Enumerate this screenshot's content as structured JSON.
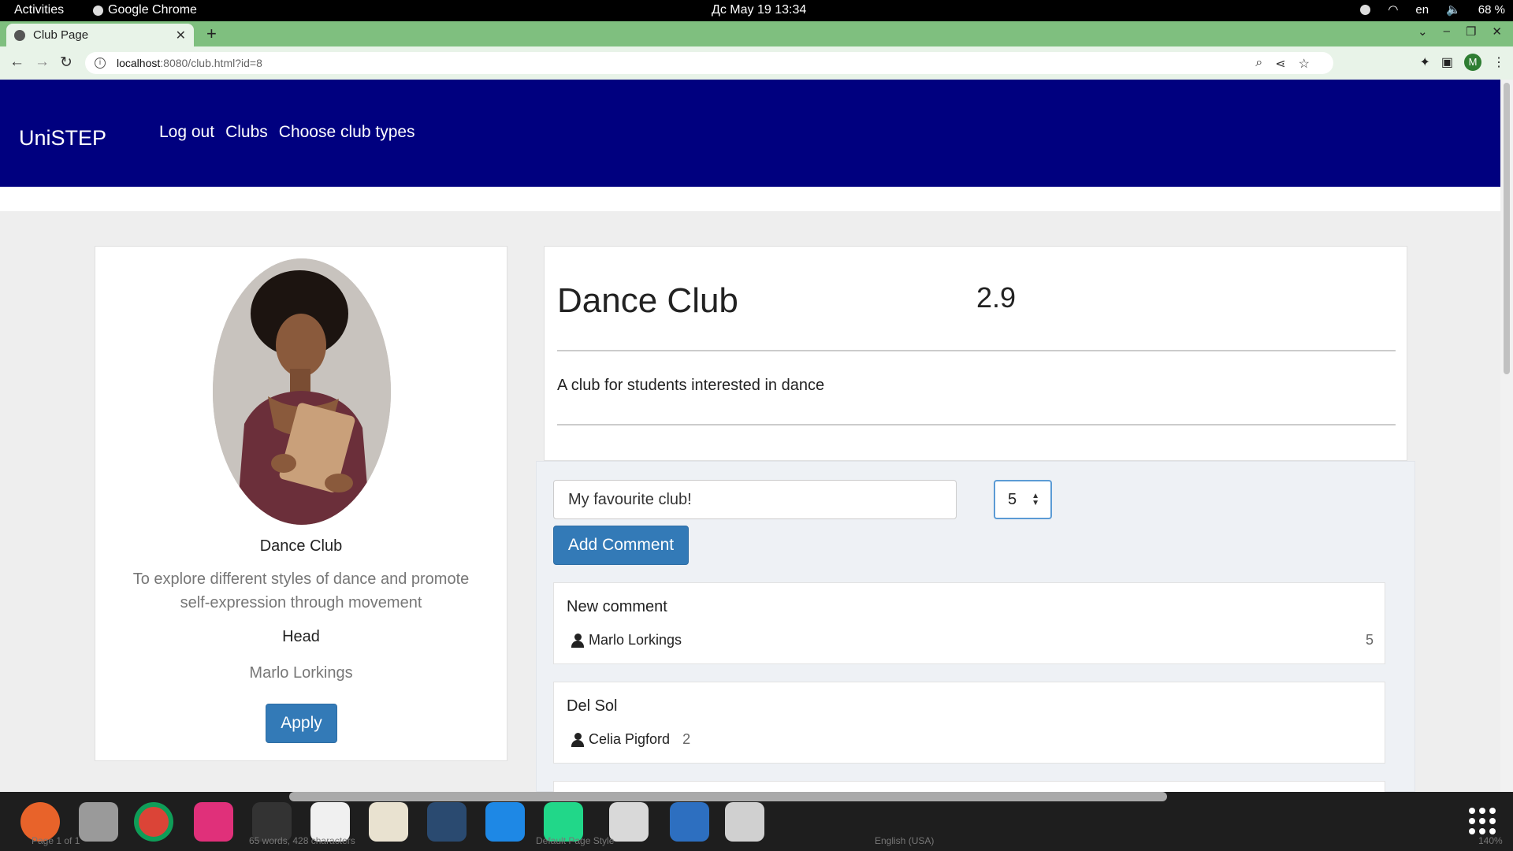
{
  "system": {
    "activities": "Activities",
    "app_name": "Google Chrome",
    "clock": "Дс May 19  13:34",
    "language": "en",
    "battery": "68 %"
  },
  "browser": {
    "tab_title": "Club Page",
    "url_host": "localhost",
    "url_path": ":8080/club.html?id=8"
  },
  "site": {
    "brand": "UniSTEP",
    "nav": [
      "Log out",
      "Clubs",
      "Choose club types"
    ]
  },
  "club_card": {
    "name": "Dance Club",
    "description": "To explore different styles of dance and promote self-expression through movement",
    "head_label": "Head",
    "head_name": "Marlo Lorkings",
    "apply_label": "Apply"
  },
  "club_header": {
    "title": "Dance Club",
    "rating": "2.9",
    "subtitle": "A club for students interested in dance"
  },
  "comment_form": {
    "input_value": "My favourite club!",
    "rating_value": "5",
    "submit_label": "Add Comment"
  },
  "comments": [
    {
      "title": "New comment",
      "author": "Marlo Lorkings",
      "score": "5"
    },
    {
      "title": "Del Sol",
      "author": "Celia Pigford",
      "score": "2"
    }
  ],
  "dock_status": {
    "page": "Page 1 of 1",
    "words": "65 words, 428 characters",
    "style": "Default Page Style",
    "lang": "English (USA)",
    "zoom": "140%"
  },
  "colors": {
    "navbar": "#00007f",
    "primary_button": "#337ab7",
    "tab_strip": "#7fbf7f"
  }
}
